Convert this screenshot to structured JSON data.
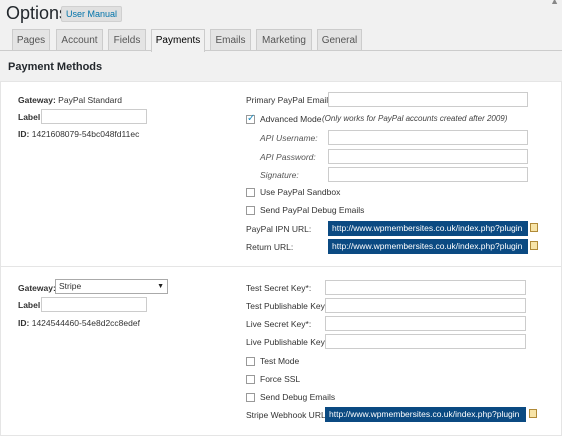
{
  "page": {
    "title": "Options",
    "manual_button": "User Manual"
  },
  "tabs": [
    {
      "label": "Pages",
      "active": false
    },
    {
      "label": "Account",
      "active": false
    },
    {
      "label": "Fields",
      "active": false
    },
    {
      "label": "Payments",
      "active": true
    },
    {
      "label": "Emails",
      "active": false
    },
    {
      "label": "Marketing",
      "active": false
    },
    {
      "label": "General",
      "active": false
    }
  ],
  "section_title": "Payment Methods",
  "gateway1": {
    "gateway_label": "Gateway:",
    "gateway_value": "PayPal Standard",
    "label_label": "Label:",
    "label_value": "",
    "id_label": "ID:",
    "id_value": "1421608079-54bc048fd11ec",
    "primary_email_label": "Primary PayPal Email*:",
    "primary_email_value": "",
    "advanced_mode_label": "Advanced Mode",
    "advanced_mode_checked": true,
    "advanced_mode_note": "(Only works for PayPal accounts created after 2009)",
    "api_username_label": "API Username:",
    "api_password_label": "API Password:",
    "signature_label": "Signature:",
    "sandbox_label": "Use PayPal Sandbox",
    "sandbox_checked": false,
    "debug_emails_label": "Send PayPal Debug Emails",
    "debug_emails_checked": false,
    "ipn_url_label": "PayPal IPN URL:",
    "ipn_url_value": "http://www.wpmembersites.co.uk/index.php?plugin",
    "return_url_label": "Return URL:",
    "return_url_value": "http://www.wpmembersites.co.uk/index.php?plugin"
  },
  "gateway2": {
    "gateway_label": "Gateway:",
    "gateway_select_value": "Stripe",
    "label_label": "Label:",
    "label_value": "",
    "id_label": "ID:",
    "id_value": "1424544460-54e8d2cc8edef",
    "test_secret_label": "Test Secret Key*:",
    "test_publishable_label": "Test Publishable Key*:",
    "live_secret_label": "Live Secret Key*:",
    "live_publishable_label": "Live Publishable Key*:",
    "test_mode_label": "Test Mode",
    "force_ssl_label": "Force SSL",
    "debug_emails_label": "Send Debug Emails",
    "webhook_label": "Stripe Webhook URL:",
    "webhook_value": "http://www.wpmembersites.co.uk/index.php?plugin"
  },
  "colors": {
    "url_bg": "#0b4a82",
    "link": "#0073aa"
  }
}
